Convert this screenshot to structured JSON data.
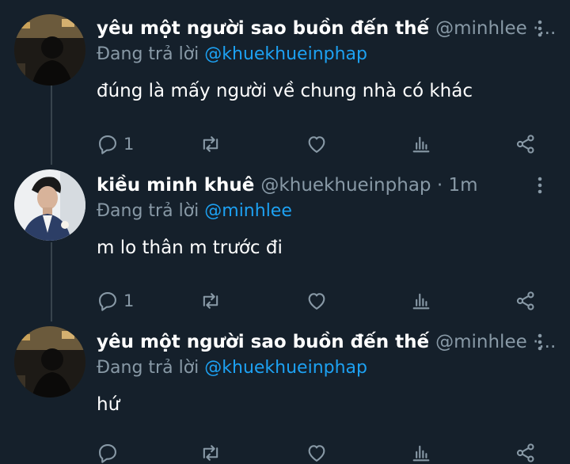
{
  "tweets": [
    {
      "name": "yêu một người sao buồn đến thế",
      "handle": "@minhlee ·...",
      "reply_prefix": "Đang trả lời ",
      "reply_to": "@khuekhueinphap",
      "text": "đúng là mấy người về chung nhà có khác",
      "reply_count": "1",
      "avatar": "dark-avatar"
    },
    {
      "name": "kiều minh khuê",
      "handle": "@khuekhueinphap · 1m",
      "reply_prefix": "Đang trả lời ",
      "reply_to": "@minhlee",
      "text": "m lo thân m trước đi",
      "reply_count": "1",
      "avatar": "portrait-avatar"
    },
    {
      "name": "yêu một người sao buồn đến thế",
      "handle": "@minhlee ·...",
      "reply_prefix": "Đang trả lời ",
      "reply_to": "@khuekhueinphap",
      "text": "hứ",
      "reply_count": "",
      "avatar": "dark-avatar"
    }
  ],
  "icons": {
    "reply": "reply-icon",
    "retweet": "retweet-icon",
    "like": "heart-icon",
    "stats": "bar-chart-icon",
    "share": "share-icon",
    "more": "more-vertical-icon"
  },
  "colors": {
    "background": "#15202b",
    "secondary_text": "#8899a6",
    "mention": "#1da1f2",
    "thread_line": "#38444d"
  }
}
